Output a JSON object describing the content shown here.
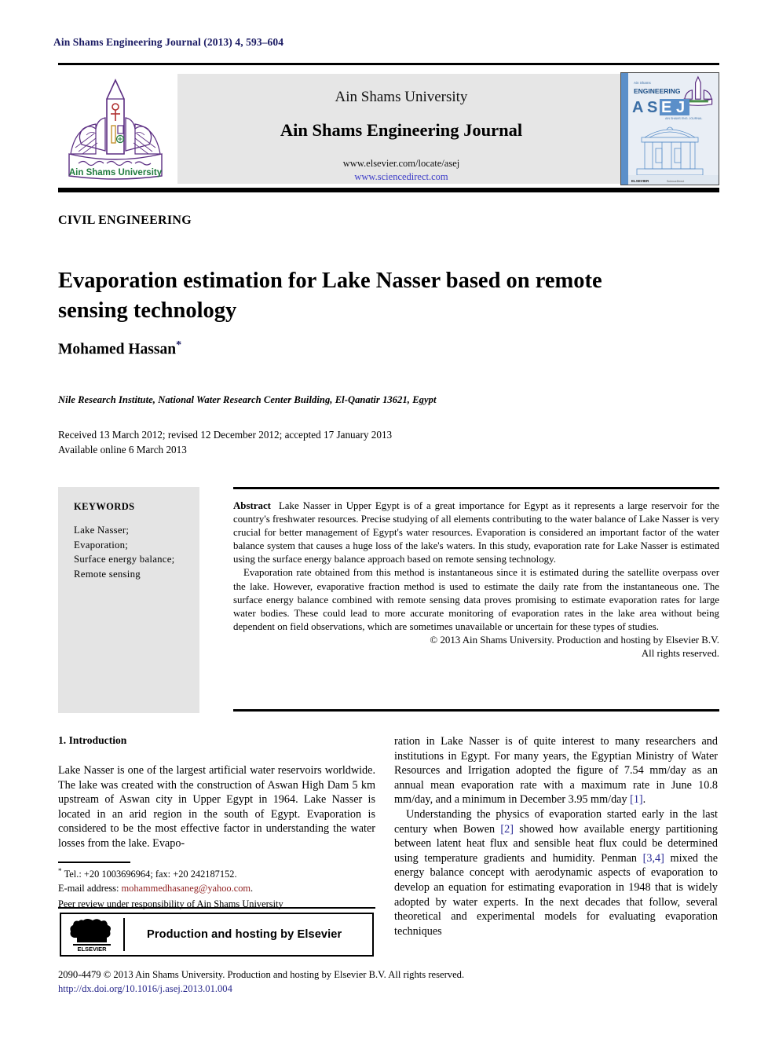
{
  "running_head": "Ain Shams Engineering Journal (2013) 4, 593–604",
  "banner": {
    "logo_alt": "ain-shams-university-crest",
    "university": "Ain Shams University",
    "journal": "Ain Shams Engineering Journal",
    "url_elsevier": "www.elsevier.com/locate/asej",
    "url_sciencedirect": "www.sciencedirect.com",
    "cover_alt": "asej-journal-cover",
    "cover_masthead_small": "Ain Shams",
    "cover_masthead": "ENGINEERING",
    "cover_acronym_1": "A",
    "cover_acronym_2": "S",
    "cover_acronym_3": "E",
    "cover_acronym_4": "J",
    "cover_subtitle": "AIN SHAMS ENGINEERING JOURNAL",
    "cover_publisher": "ELSEVIER"
  },
  "section_kicker": "CIVIL ENGINEERING",
  "title": "Evaporation estimation for Lake Nasser based on remote sensing technology",
  "author": "Mohamed Hassan",
  "author_marker": "*",
  "affiliation": "Nile Research Institute, National Water Research Center Building, El-Qanatir 13621, Egypt",
  "history_received": "Received 13 March 2012; revised 12 December 2012; accepted 17 January 2013",
  "history_online": "Available online 6 March 2013",
  "keywords": {
    "title": "KEYWORDS",
    "items": "Lake Nasser;\nEvaporation;\nSurface energy balance;\nRemote sensing"
  },
  "abstract": {
    "label": "Abstract",
    "para1": "Lake Nasser in Upper Egypt is of a great importance for Egypt as it represents a large reservoir for the country's freshwater resources. Precise studying of all elements contributing to the water balance of Lake Nasser is very crucial for better management of Egypt's water resources. Evaporation is considered an important factor of the water balance system that causes a huge loss of the lake's waters. In this study, evaporation rate for Lake Nasser is estimated using the surface energy balance approach based on remote sensing technology.",
    "para2": "Evaporation rate obtained from this method is instantaneous since it is estimated during the satellite overpass over the lake. However, evaporative fraction method is used to estimate the daily rate from the instantaneous one. The surface energy balance combined with remote sensing data proves promising to estimate evaporation rates for large water bodies. These could lead to more accurate monitoring of evaporation rates in the lake area without being dependent on field observations, which are sometimes unavailable or uncertain for these types of studies.",
    "copyright_line1": "© 2013 Ain Shams University. Production and hosting by Elsevier B.V.",
    "copyright_line2": "All rights reserved."
  },
  "intro": {
    "heading": "1. Introduction",
    "left_para": "Lake Nasser is one of the largest artificial water reservoirs worldwide. The lake was created with the construction of Aswan High Dam 5 km upstream of Aswan city in Upper Egypt in 1964. Lake Nasser is located in an arid region in the south of Egypt. Evaporation is considered to be the most effective factor in understanding the water losses from the lake. Evapo-",
    "right_para1_a": "ration in Lake Nasser is of quite interest to many researchers and institutions in Egypt. For many years, the Egyptian Ministry of Water Resources and Irrigation adopted the figure of 7.54 mm/day as an annual mean evaporation rate with a maximum rate in June 10.8 mm/day, and a minimum in December 3.95 mm/day ",
    "right_para1_ref": "[1]",
    "right_para1_b": ".",
    "right_para2_a": "Understanding the physics of evaporation started early in the last century when Bowen ",
    "right_para2_ref1": "[2]",
    "right_para2_b": " showed how available energy partitioning between latent heat flux and sensible heat flux could be determined using temperature gradients and humidity. Penman ",
    "right_para2_ref2": "[3,4]",
    "right_para2_c": " mixed the energy balance concept with aerodynamic aspects of evaporation to develop an equation for estimating evaporation in 1948 that is widely adopted by water experts. In the next decades that follow, several theoretical and experimental models for evaluating evaporation techniques"
  },
  "footnotes": {
    "tel": "Tel.: +20 1003696964; fax: +20 242187152.",
    "email_label": "E-mail address: ",
    "email": "mohammedhasaneg@yahoo.com",
    "email_end": ".",
    "peer_review": "Peer review under responsibility of Ain Shams University"
  },
  "hosting": {
    "logo_alt": "elsevier-tree-logo",
    "logo_word": "ELSEVIER",
    "text": "Production and hosting by Elsevier"
  },
  "footer": {
    "line1": "2090-4479 © 2013 Ain Shams University. Production and hosting by Elsevier B.V. All rights reserved.",
    "doi": "http://dx.doi.org/10.1016/j.asej.2013.01.004"
  },
  "colors": {
    "running_head": "#1a1a63",
    "link_blue": "#3c3cc8",
    "ref_blue": "#2b2b96",
    "email_red": "#8f1f1f",
    "banner_gray": "#e6e6e6",
    "keyword_gray": "#e4e4e4",
    "crest_purple": "#5b2d82",
    "crest_green": "#1f7a3d",
    "cover_blue": "#5b8fc9"
  }
}
